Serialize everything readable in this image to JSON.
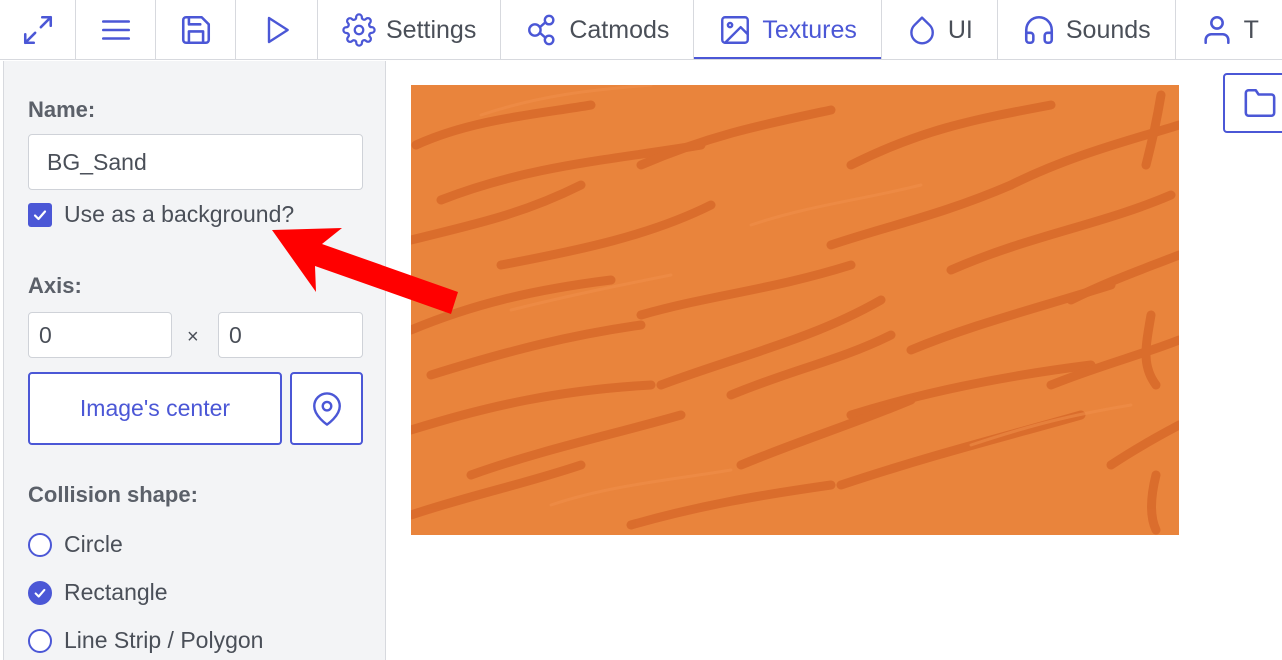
{
  "toolbar": {
    "icons": [
      "fullscreen-icon",
      "menu-icon",
      "save-icon",
      "play-icon"
    ],
    "tabs": [
      {
        "label": "Settings",
        "icon": "gear-icon"
      },
      {
        "label": "Catmods",
        "icon": "modules-icon"
      },
      {
        "label": "Textures",
        "icon": "image-icon",
        "active": true
      },
      {
        "label": "UI",
        "icon": "droplet-icon"
      },
      {
        "label": "Sounds",
        "icon": "headphones-icon"
      },
      {
        "label": "T",
        "icon": "user-icon"
      }
    ]
  },
  "texture_editor": {
    "name_label": "Name:",
    "name_value": "BG_Sand",
    "background_checkbox": {
      "label": "Use as a background?",
      "checked": true
    },
    "axis_label": "Axis:",
    "axis_x": "0",
    "axis_separator": "×",
    "axis_y": "0",
    "image_center_button": "Image's center",
    "collision_label": "Collision shape:",
    "collision_options": [
      {
        "label": "Circle",
        "checked": false
      },
      {
        "label": "Rectangle",
        "checked": true
      },
      {
        "label": "Line Strip / Polygon",
        "checked": false
      }
    ]
  },
  "colors": {
    "accent": "#4b57d6",
    "texture": "#e9843c",
    "texture_stripe": "#d8692a",
    "arrow": "#ff0000"
  }
}
